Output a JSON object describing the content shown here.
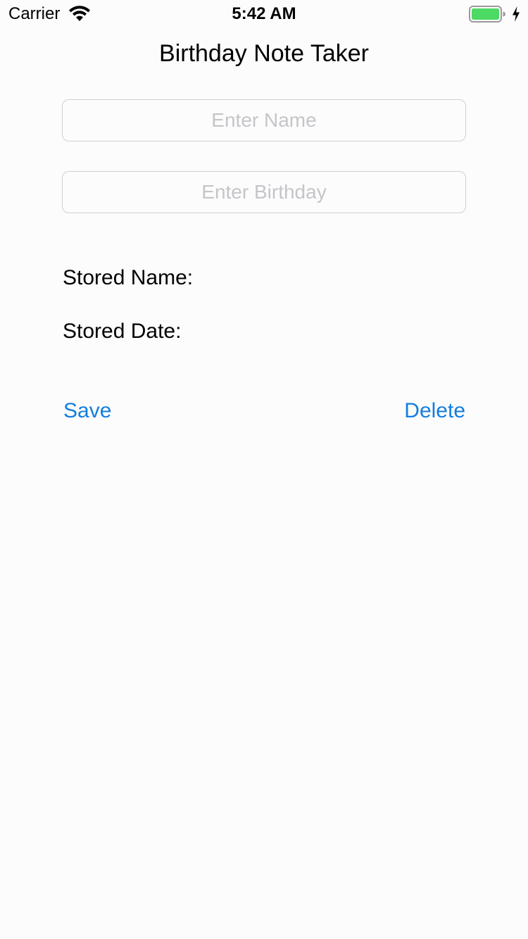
{
  "status_bar": {
    "carrier": "Carrier",
    "time": "5:42 AM",
    "battery_color": "#4cd964"
  },
  "nav": {
    "title": "Birthday Note Taker"
  },
  "form": {
    "name_placeholder": "Enter Name",
    "name_value": "",
    "birthday_placeholder": "Enter Birthday",
    "birthday_value": ""
  },
  "stored": {
    "name_label": "Stored Name:",
    "date_label": "Stored Date:"
  },
  "actions": {
    "save_label": "Save",
    "delete_label": "Delete",
    "accent_color": "#147ee0"
  }
}
